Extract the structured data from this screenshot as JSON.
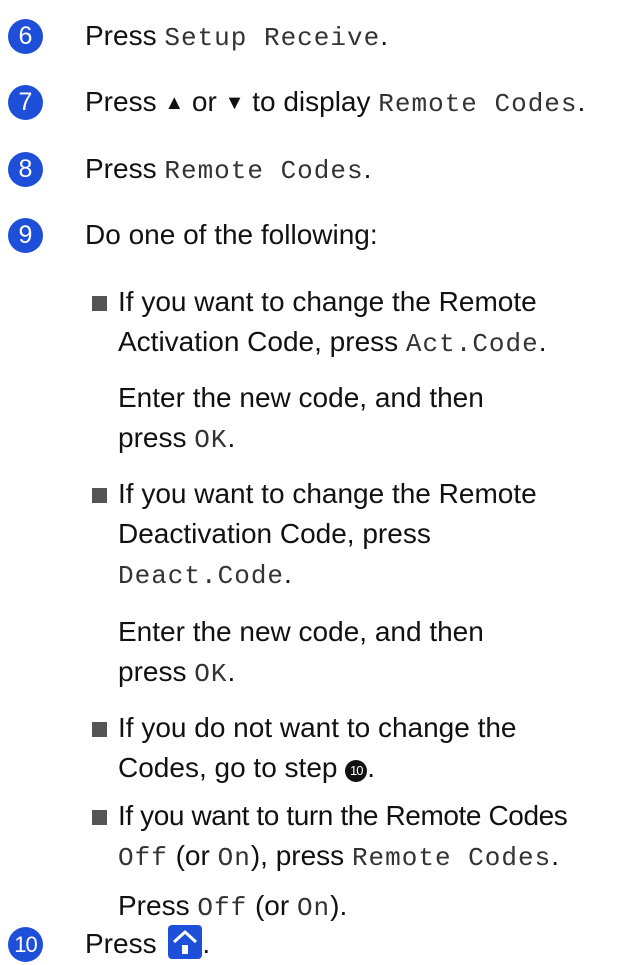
{
  "steps": [
    {
      "num": "6",
      "prefix": "Press ",
      "code": "Setup Receive",
      "suffix": "."
    },
    {
      "num": "7",
      "prefix": "Press ",
      "up": "▲",
      "or": " or ",
      "down": "▼",
      "mid": " to display ",
      "code": "Remote Codes",
      "suffix": "."
    },
    {
      "num": "8",
      "prefix": "Press ",
      "code": "Remote Codes",
      "suffix": "."
    },
    {
      "num": "9",
      "text": "Do one of the following:"
    },
    {
      "num": "10",
      "prefix": "Press ",
      "suffix": "."
    }
  ],
  "bullets": [
    {
      "line1": "If you want to change the Remote",
      "line2_text": "Activation Code, press ",
      "line2_code": "Act.Code",
      "line2_end": ".",
      "sub_line1": "Enter the new code, and then",
      "sub_press": "press ",
      "sub_code": "OK",
      "sub_end": "."
    },
    {
      "line1": "If you want to change the Remote",
      "line2_text": "Deactivation Code, press",
      "line3_code": "Deact.Code",
      "line3_end": ".",
      "sub_line1": "Enter the new code, and then",
      "sub_press": "press ",
      "sub_code": "OK",
      "sub_end": "."
    },
    {
      "line1": "If you do not want to change the",
      "line2_text": "Codes, go to step ",
      "ref": "10",
      "line2_end": "."
    },
    {
      "line1": "If you want to turn the Remote Codes",
      "l2_code1": "Off",
      "l2_t1": " (or ",
      "l2_code2": "On",
      "l2_t2": "), press ",
      "l2_code3": "Remote Codes",
      "l2_end": ".",
      "sub_press": "Press ",
      "sub_code1": "Off",
      "sub_t1": " (or ",
      "sub_code2": "On",
      "sub_end": ")."
    }
  ],
  "colors": {
    "step_badge": "#1d4fd8",
    "home_button": "#1d4fd8"
  },
  "icons": {
    "home": "home-icon"
  }
}
